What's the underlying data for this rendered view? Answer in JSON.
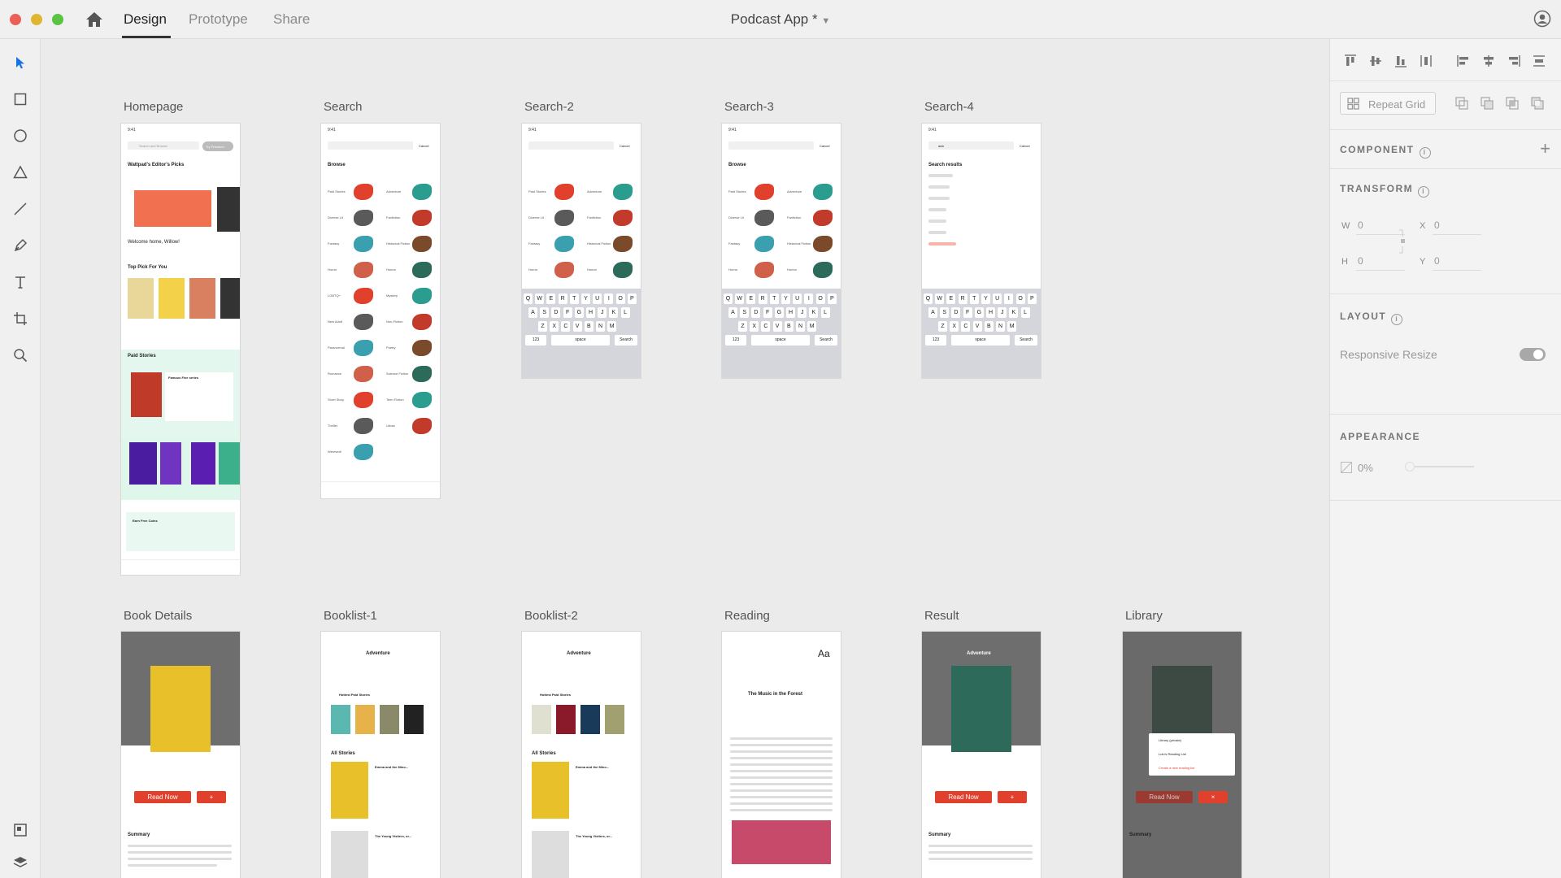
{
  "titlebar": {
    "tabs": [
      "Design",
      "Prototype",
      "Share"
    ],
    "document_title": "Podcast App *"
  },
  "boards": {
    "row1": [
      "Homepage",
      "Search",
      "Search-2",
      "Search-3",
      "Search-4"
    ],
    "row2": [
      "Book Details",
      "Booklist-1",
      "Booklist-2",
      "Reading",
      "Result",
      "Library"
    ]
  },
  "mock": {
    "homepage": {
      "search_placeholder": "Search and Browse",
      "premium": "Try Premium",
      "editors_picks": "Wattpad's Editor's Picks",
      "welcome": "Welcome home, Willow!",
      "top_pick": "Top Pick For You",
      "paid_stories": "Paid Stories",
      "famous_five": "Famous Five series",
      "earn_coins": "Earn Free Coins"
    },
    "search": {
      "cancel": "Cancel",
      "browse": "Browse",
      "left_genres": [
        "Paid Stories",
        "Diverse Lit",
        "Fantasy",
        "Horror",
        "LGBTQ+",
        "New Adult",
        "Paranormal",
        "Romance",
        "Short Story",
        "Thriller",
        "Werewolf"
      ],
      "right_genres": [
        "Adventure",
        "Fanfiction",
        "Historical Fiction",
        "Humor",
        "Mystery",
        "Non-Fiction",
        "Poetry",
        "Science Fiction",
        "Teen Fiction",
        "Urban"
      ],
      "search_results": "Search results",
      "query": "ada",
      "keyboard_rows": [
        [
          "Q",
          "W",
          "E",
          "R",
          "T",
          "Y",
          "U",
          "I",
          "O",
          "P"
        ],
        [
          "A",
          "S",
          "D",
          "F",
          "G",
          "H",
          "J",
          "K",
          "L"
        ],
        [
          "Z",
          "X",
          "C",
          "V",
          "B",
          "N",
          "M"
        ]
      ],
      "space": "space",
      "search_key": "Search",
      "num_key": "123"
    },
    "details": {
      "read_now": "Read Now",
      "summary": "Summary",
      "adventure": "Adventure",
      "hottest": "Hottest Paid Stories",
      "all_stories": "All Stories",
      "story1": "Emma and the Mino...",
      "story2": "The Young Visiters, or...",
      "music": "The Music in the Forest",
      "library_menu": [
        "Library (private)",
        "Lulu's Reading List",
        "Create a new reading list"
      ]
    }
  },
  "panel": {
    "repeat_grid": "Repeat Grid",
    "component": "COMPONENT",
    "transform": "TRANSFORM",
    "w_label": "W",
    "w_val": "0",
    "x_label": "X",
    "x_val": "0",
    "h_label": "H",
    "h_val": "0",
    "y_label": "Y",
    "y_val": "0",
    "layout": "LAYOUT",
    "responsive": "Responsive Resize",
    "appearance": "APPEARANCE",
    "opacity": "0%"
  },
  "colors": {
    "accent": "#e0402c",
    "tool_active": "#1473e6"
  }
}
